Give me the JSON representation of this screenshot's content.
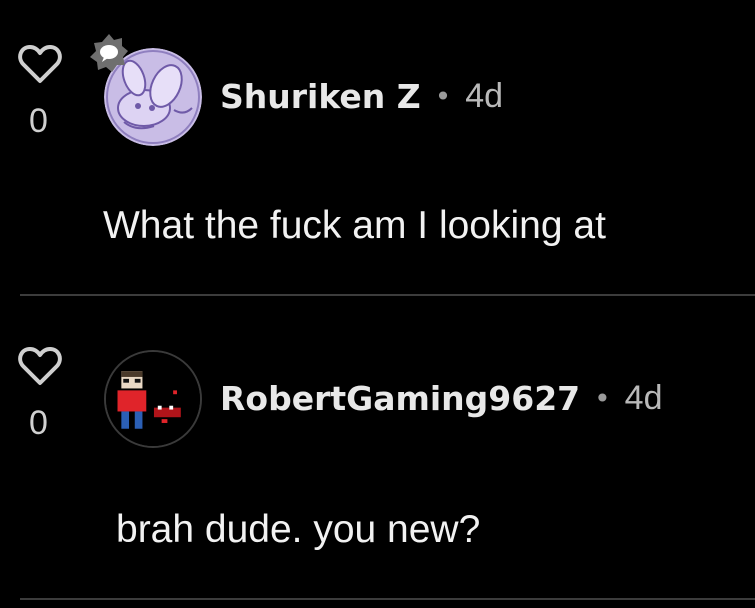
{
  "comments": [
    {
      "username": "Shuriken Z",
      "separator": "•",
      "time": "4d",
      "text": "What the fuck am I looking at",
      "likes": "0",
      "avatar_icon": "purple-bunny-avatar",
      "has_badge": true
    },
    {
      "username": "RobertGaming9627",
      "separator": "•",
      "time": "4d",
      "text": "brah dude. you new?",
      "likes": "0",
      "avatar_icon": "pixel-character-avatar",
      "has_badge": false
    }
  ],
  "colors": {
    "background": "#000000",
    "text": "#f2f2f2",
    "muted": "#b9b9b9",
    "divider": "#3c3c3c",
    "badge": "#6f6f6f"
  }
}
